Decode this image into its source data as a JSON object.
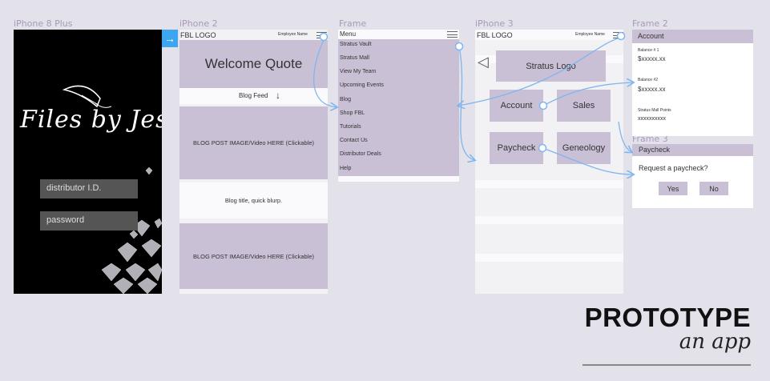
{
  "frames": {
    "iphone8plus": "iPhone 8 Plus",
    "iphone2": "iPhone 2",
    "frame_menu": "Frame",
    "iphone3": "iPhone 3",
    "frame2": "Frame 2",
    "frame3": "Frame 3"
  },
  "login": {
    "logo_text": "Files by Jess",
    "distributor_placeholder": "distributor I.D.",
    "password_placeholder": "password",
    "next_arrow": "→"
  },
  "home": {
    "logo": "FBL LOGO",
    "employee": "Employee Name",
    "welcome": "Welcome Quote",
    "blog_feed": "Blog Feed",
    "blog_feed_arrow": "↓",
    "post1": "BLOG POST IMAGE/Video HERE (Clickable)",
    "blurb": "Blog title, quick blurp.",
    "post2": "BLOG POST IMAGE/Video HERE (Clickable)"
  },
  "menu": {
    "title": "Menu",
    "items": [
      "Stratus Vault",
      "Stratus Mall",
      "View My Team",
      "Upcoming Events",
      "Blog",
      "Shop FBL",
      "Tutorials",
      "Contact Us",
      "Distributor Deals",
      "Help"
    ]
  },
  "dashboard": {
    "logo": "FBL LOGO",
    "employee": "Employee Name",
    "back": "◁",
    "stratus_logo": "Stratus Logo",
    "account": "Account",
    "sales": "Sales",
    "paycheck": "Paycheck",
    "geneology": "Geneology"
  },
  "account": {
    "title": "Account",
    "balance1_label": "Balance # 1",
    "balance1_value": "$xxxxx.xx",
    "balance2_label": "Balance #2",
    "balance2_value": "$xxxxx.xx",
    "points_label": "Stratus Mall Points",
    "points_value": "xxxxxxxxxx"
  },
  "paycheck": {
    "title": "Paycheck",
    "question": "Request a paycheck?",
    "yes": "Yes",
    "no": "No"
  },
  "footer": {
    "title": "PROTOTYPE",
    "subtitle": "an app"
  },
  "colors": {
    "background": "#e3e1ea",
    "block": "#c9c0d6",
    "arrow": "#7fb6ee",
    "label": "#a79bb8"
  }
}
